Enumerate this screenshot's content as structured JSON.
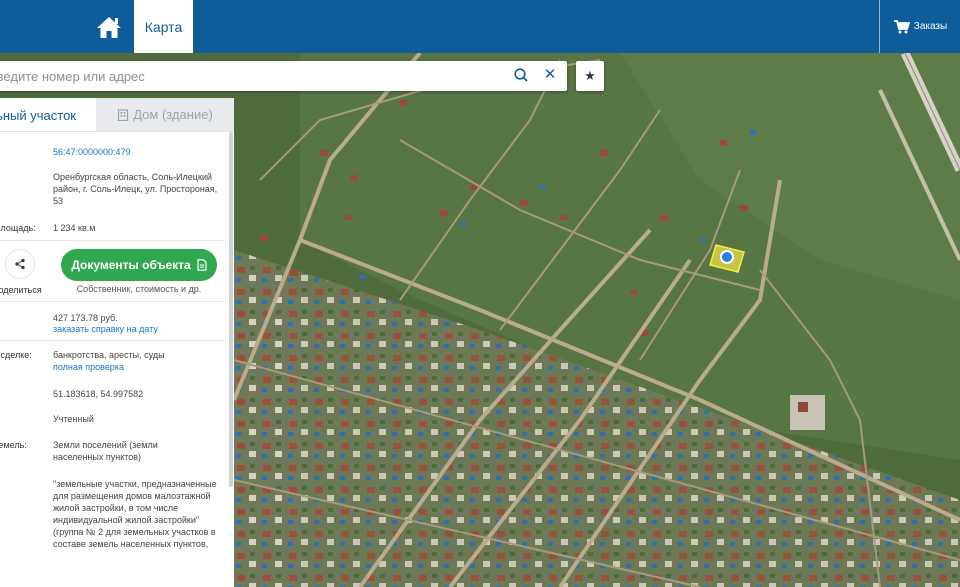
{
  "topbar": {
    "tab_map": "Карта",
    "orders": "Заказы"
  },
  "search": {
    "placeholder": "Введите номер или адрес"
  },
  "panel": {
    "tab_land": "Земельный участок",
    "tab_house": "Дом (здание)",
    "cadastral_number": "56:47:0000000:479",
    "address": "Оренбургская область, Соль-Илецкий район, г. Соль-Илецк, ул. Простороная, 53",
    "area_label": "Площадь:",
    "area_value": "1 234 кв.м",
    "share_label": "Поделиться",
    "docs_button": "Документы объекта",
    "docs_sub": "Собственник, стоимость и др.",
    "cost_value": "427 173.78 руб.",
    "cost_link": "заказать справку на дату",
    "deal_label": "В сделке:",
    "deal_value": "банкротства, аресты, суды",
    "deal_link": "полная проверка",
    "coords": "51.183618, 54.997582",
    "status": "Учтенный",
    "category_label": "Земель:",
    "category_value": "Земли поселений (земли населенных пунктов)",
    "use_value": "\"земельные участки, предназначенные для размещения домов малоэтажной жилой застройки, в том числе индивидуальной жилой застройки\" (группа № 2 для земельных участков в составе земель населенных пунктов,"
  },
  "colors": {
    "brand": "#0f5c9b",
    "accent_green": "#2fa84f",
    "link": "#1676c9"
  }
}
